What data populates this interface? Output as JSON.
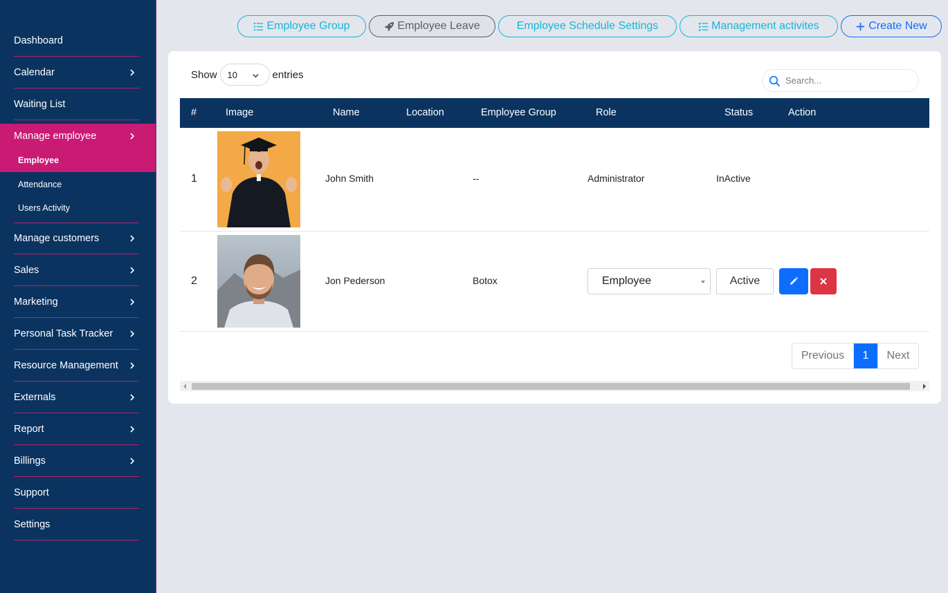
{
  "sidebar": {
    "items": [
      {
        "label": "Dashboard",
        "has_chevron": false
      },
      {
        "label": "Calendar",
        "has_chevron": true
      },
      {
        "label": "Waiting List",
        "has_chevron": false
      },
      {
        "label": "Manage employee",
        "has_chevron": true,
        "active": true
      },
      {
        "label": "Manage customers",
        "has_chevron": true
      },
      {
        "label": "Sales",
        "has_chevron": true
      },
      {
        "label": "Marketing",
        "has_chevron": true
      },
      {
        "label": "Personal Task Tracker",
        "has_chevron": true
      },
      {
        "label": "Resource Management",
        "has_chevron": true
      },
      {
        "label": "Externals",
        "has_chevron": true
      },
      {
        "label": "Report",
        "has_chevron": true
      },
      {
        "label": "Billings",
        "has_chevron": true
      },
      {
        "label": "Support",
        "has_chevron": false
      },
      {
        "label": "Settings",
        "has_chevron": false
      }
    ],
    "subitems": [
      {
        "label": "Employee",
        "active": true
      },
      {
        "label": "Attendance"
      },
      {
        "label": "Users Activity"
      }
    ]
  },
  "toolbar": {
    "employee_group": "Employee Group",
    "employee_leave": "Employee Leave",
    "schedule_settings": "Employee Schedule Settings",
    "management_activities": "Management activites",
    "create_new": "Create New"
  },
  "table_controls": {
    "show_label": "Show",
    "entries_value": "10",
    "entries_label": "entries",
    "search_placeholder": "Search..."
  },
  "table": {
    "headers": [
      "#",
      "Image",
      "Name",
      "Location",
      "Employee Group",
      "Role",
      "Status",
      "Action"
    ],
    "rows": [
      {
        "num": "1",
        "photo": "graduate-photo",
        "name": "John Smith",
        "location": "",
        "group": "--",
        "role": "Administrator",
        "status": "InActive"
      },
      {
        "num": "2",
        "photo": "man-portrait-photo",
        "name": "Jon Pederson",
        "location": "",
        "group": "Botox",
        "role": "Employee",
        "status": "Active"
      }
    ]
  },
  "pagination": {
    "previous": "Previous",
    "page": "1",
    "next": "Next"
  },
  "colors": {
    "sidebar_bg": "#0a3360",
    "active_accent": "#c91a74",
    "primary": "#0d6efd",
    "danger": "#dc3545",
    "teal": "#17b4d6"
  }
}
